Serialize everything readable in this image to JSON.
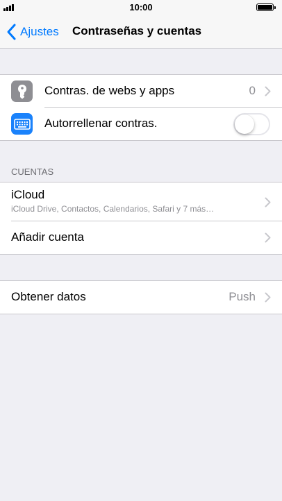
{
  "status_bar": {
    "time": "10:00"
  },
  "nav": {
    "back_label": "Ajustes",
    "title": "Contraseñas y cuentas"
  },
  "passwords_group": {
    "items": [
      {
        "label": "Contras. de webs y apps",
        "value": "0",
        "icon": "key-icon",
        "icon_color": "#8e8e93"
      },
      {
        "label": "Autorrellenar contras.",
        "toggle_on": false,
        "icon": "keyboard-icon",
        "icon_color": "#1a82fb"
      }
    ]
  },
  "accounts": {
    "section_header": "CUENTAS",
    "icloud": {
      "title": "iCloud",
      "subtitle": "iCloud Drive, Contactos, Calendarios, Safari y 7 más…"
    },
    "add_account_label": "Añadir cuenta"
  },
  "fetch": {
    "label": "Obtener datos",
    "value": "Push"
  },
  "colors": {
    "accent": "#007aff",
    "background": "#efeff4",
    "separator": "#c8c7cc"
  }
}
